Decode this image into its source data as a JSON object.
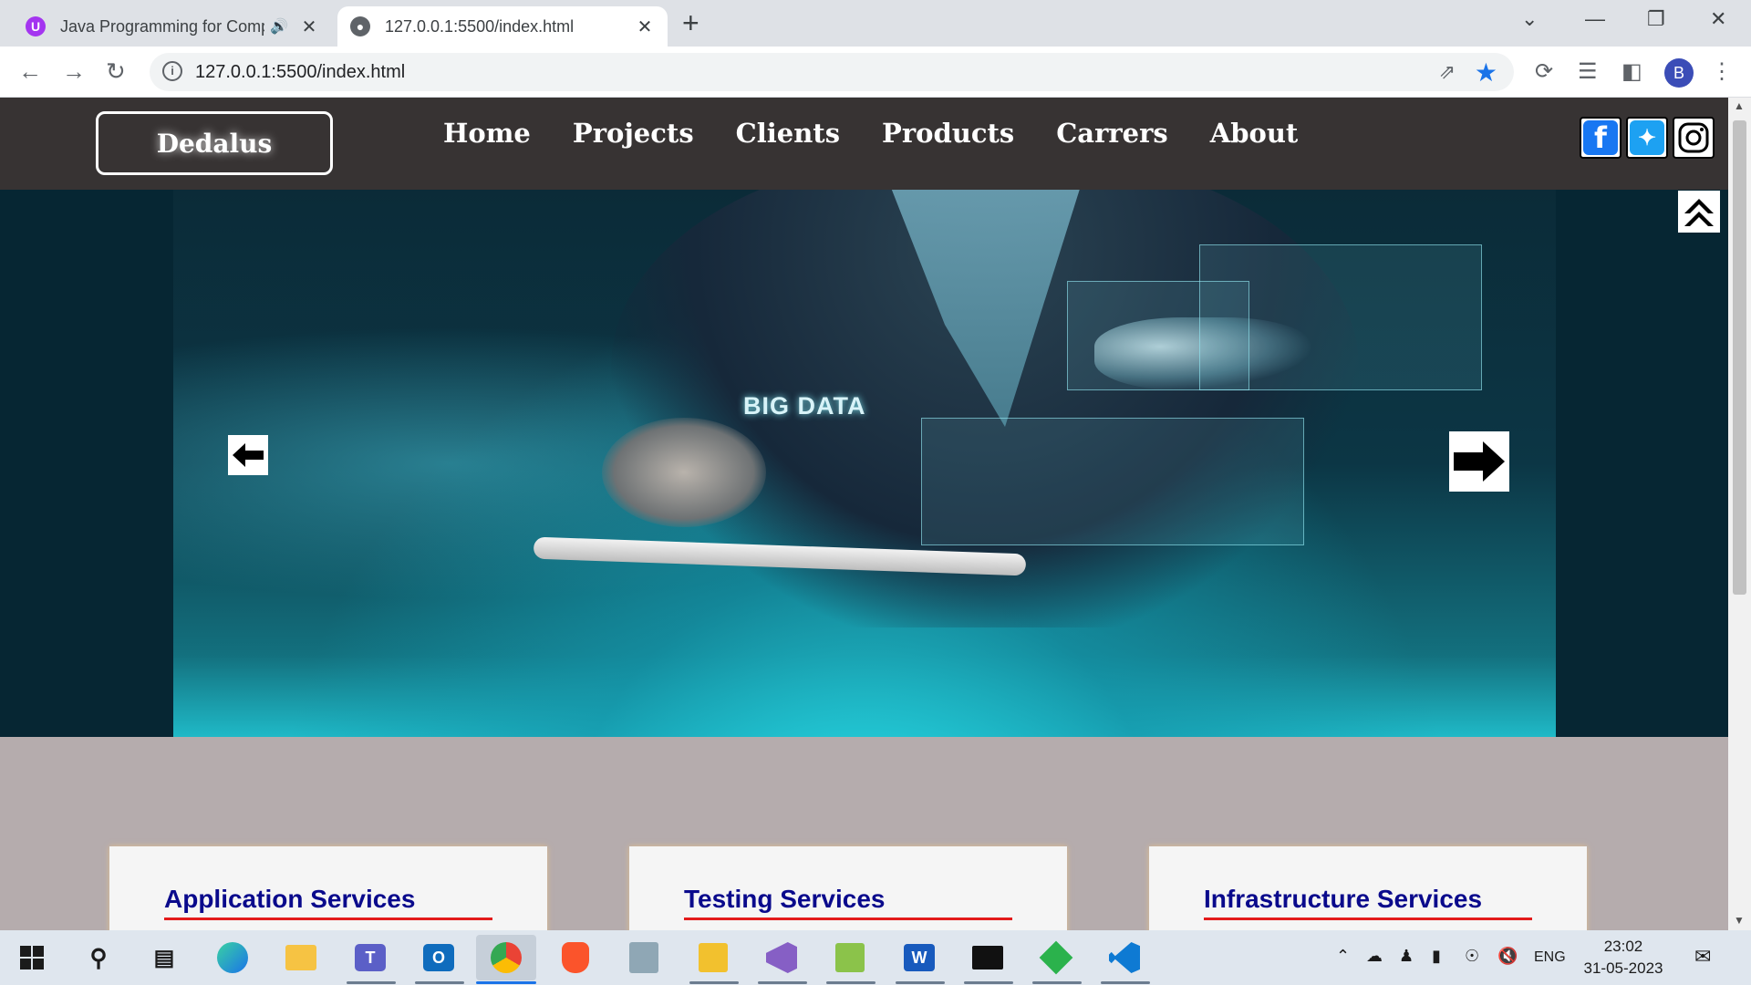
{
  "browser": {
    "tabs": [
      {
        "title": "Java Programming for Comp",
        "active": false,
        "favicon": "udemy-icon",
        "muted_icon": "speaker-icon"
      },
      {
        "title": "127.0.0.1:5500/index.html",
        "active": true,
        "favicon": "globe-icon"
      }
    ],
    "address": {
      "url": "127.0.0.1:5500/index.html"
    },
    "profile_initial": "B"
  },
  "site": {
    "brand": "Dedalus",
    "nav": [
      "Home",
      "Projects",
      "Clients",
      "Products",
      "Carrers",
      "About"
    ],
    "hero": {
      "overlay_text": "BIG DATA"
    },
    "cards": [
      {
        "title": "Application Services"
      },
      {
        "title": "Testing Services"
      },
      {
        "title": "Infrastructure Services"
      }
    ],
    "colors": {
      "header_bg": "#373333",
      "page_bg": "#b5acad",
      "card_title": "#0a0a8c",
      "card_rule": "#e31b1b"
    }
  },
  "taskbar": {
    "apps": [
      "windows-start-icon",
      "search-icon",
      "task-view-icon",
      "edge-icon",
      "file-explorer-icon",
      "teams-icon",
      "outlook-icon",
      "chrome-icon",
      "brave-icon",
      "app-icon",
      "paint-icon",
      "visual-studio-icon",
      "notepad-plus-icon",
      "word-icon",
      "terminal-icon",
      "git-icon",
      "vscode-icon"
    ],
    "language": "ENG",
    "time": "23:02",
    "date": "31-05-2023"
  }
}
